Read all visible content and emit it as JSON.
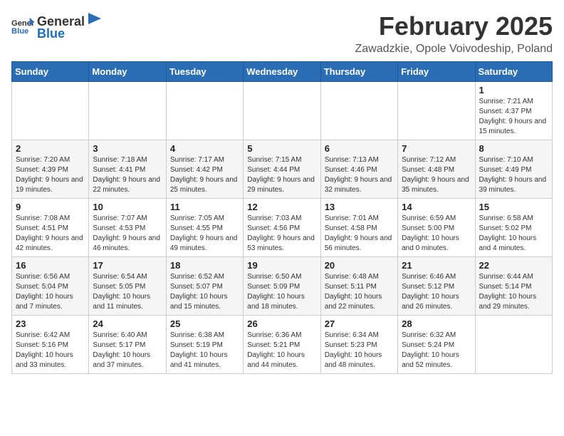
{
  "logo": {
    "text_general": "General",
    "text_blue": "Blue"
  },
  "header": {
    "month_title": "February 2025",
    "location": "Zawadzkie, Opole Voivodeship, Poland"
  },
  "weekdays": [
    "Sunday",
    "Monday",
    "Tuesday",
    "Wednesday",
    "Thursday",
    "Friday",
    "Saturday"
  ],
  "weeks": [
    [
      {
        "day": "",
        "detail": ""
      },
      {
        "day": "",
        "detail": ""
      },
      {
        "day": "",
        "detail": ""
      },
      {
        "day": "",
        "detail": ""
      },
      {
        "day": "",
        "detail": ""
      },
      {
        "day": "",
        "detail": ""
      },
      {
        "day": "1",
        "detail": "Sunrise: 7:21 AM\nSunset: 4:37 PM\nDaylight: 9 hours and 15 minutes."
      }
    ],
    [
      {
        "day": "2",
        "detail": "Sunrise: 7:20 AM\nSunset: 4:39 PM\nDaylight: 9 hours and 19 minutes."
      },
      {
        "day": "3",
        "detail": "Sunrise: 7:18 AM\nSunset: 4:41 PM\nDaylight: 9 hours and 22 minutes."
      },
      {
        "day": "4",
        "detail": "Sunrise: 7:17 AM\nSunset: 4:42 PM\nDaylight: 9 hours and 25 minutes."
      },
      {
        "day": "5",
        "detail": "Sunrise: 7:15 AM\nSunset: 4:44 PM\nDaylight: 9 hours and 29 minutes."
      },
      {
        "day": "6",
        "detail": "Sunrise: 7:13 AM\nSunset: 4:46 PM\nDaylight: 9 hours and 32 minutes."
      },
      {
        "day": "7",
        "detail": "Sunrise: 7:12 AM\nSunset: 4:48 PM\nDaylight: 9 hours and 35 minutes."
      },
      {
        "day": "8",
        "detail": "Sunrise: 7:10 AM\nSunset: 4:49 PM\nDaylight: 9 hours and 39 minutes."
      }
    ],
    [
      {
        "day": "9",
        "detail": "Sunrise: 7:08 AM\nSunset: 4:51 PM\nDaylight: 9 hours and 42 minutes."
      },
      {
        "day": "10",
        "detail": "Sunrise: 7:07 AM\nSunset: 4:53 PM\nDaylight: 9 hours and 46 minutes."
      },
      {
        "day": "11",
        "detail": "Sunrise: 7:05 AM\nSunset: 4:55 PM\nDaylight: 9 hours and 49 minutes."
      },
      {
        "day": "12",
        "detail": "Sunrise: 7:03 AM\nSunset: 4:56 PM\nDaylight: 9 hours and 53 minutes."
      },
      {
        "day": "13",
        "detail": "Sunrise: 7:01 AM\nSunset: 4:58 PM\nDaylight: 9 hours and 56 minutes."
      },
      {
        "day": "14",
        "detail": "Sunrise: 6:59 AM\nSunset: 5:00 PM\nDaylight: 10 hours and 0 minutes."
      },
      {
        "day": "15",
        "detail": "Sunrise: 6:58 AM\nSunset: 5:02 PM\nDaylight: 10 hours and 4 minutes."
      }
    ],
    [
      {
        "day": "16",
        "detail": "Sunrise: 6:56 AM\nSunset: 5:04 PM\nDaylight: 10 hours and 7 minutes."
      },
      {
        "day": "17",
        "detail": "Sunrise: 6:54 AM\nSunset: 5:05 PM\nDaylight: 10 hours and 11 minutes."
      },
      {
        "day": "18",
        "detail": "Sunrise: 6:52 AM\nSunset: 5:07 PM\nDaylight: 10 hours and 15 minutes."
      },
      {
        "day": "19",
        "detail": "Sunrise: 6:50 AM\nSunset: 5:09 PM\nDaylight: 10 hours and 18 minutes."
      },
      {
        "day": "20",
        "detail": "Sunrise: 6:48 AM\nSunset: 5:11 PM\nDaylight: 10 hours and 22 minutes."
      },
      {
        "day": "21",
        "detail": "Sunrise: 6:46 AM\nSunset: 5:12 PM\nDaylight: 10 hours and 26 minutes."
      },
      {
        "day": "22",
        "detail": "Sunrise: 6:44 AM\nSunset: 5:14 PM\nDaylight: 10 hours and 29 minutes."
      }
    ],
    [
      {
        "day": "23",
        "detail": "Sunrise: 6:42 AM\nSunset: 5:16 PM\nDaylight: 10 hours and 33 minutes."
      },
      {
        "day": "24",
        "detail": "Sunrise: 6:40 AM\nSunset: 5:17 PM\nDaylight: 10 hours and 37 minutes."
      },
      {
        "day": "25",
        "detail": "Sunrise: 6:38 AM\nSunset: 5:19 PM\nDaylight: 10 hours and 41 minutes."
      },
      {
        "day": "26",
        "detail": "Sunrise: 6:36 AM\nSunset: 5:21 PM\nDaylight: 10 hours and 44 minutes."
      },
      {
        "day": "27",
        "detail": "Sunrise: 6:34 AM\nSunset: 5:23 PM\nDaylight: 10 hours and 48 minutes."
      },
      {
        "day": "28",
        "detail": "Sunrise: 6:32 AM\nSunset: 5:24 PM\nDaylight: 10 hours and 52 minutes."
      },
      {
        "day": "",
        "detail": ""
      }
    ]
  ]
}
